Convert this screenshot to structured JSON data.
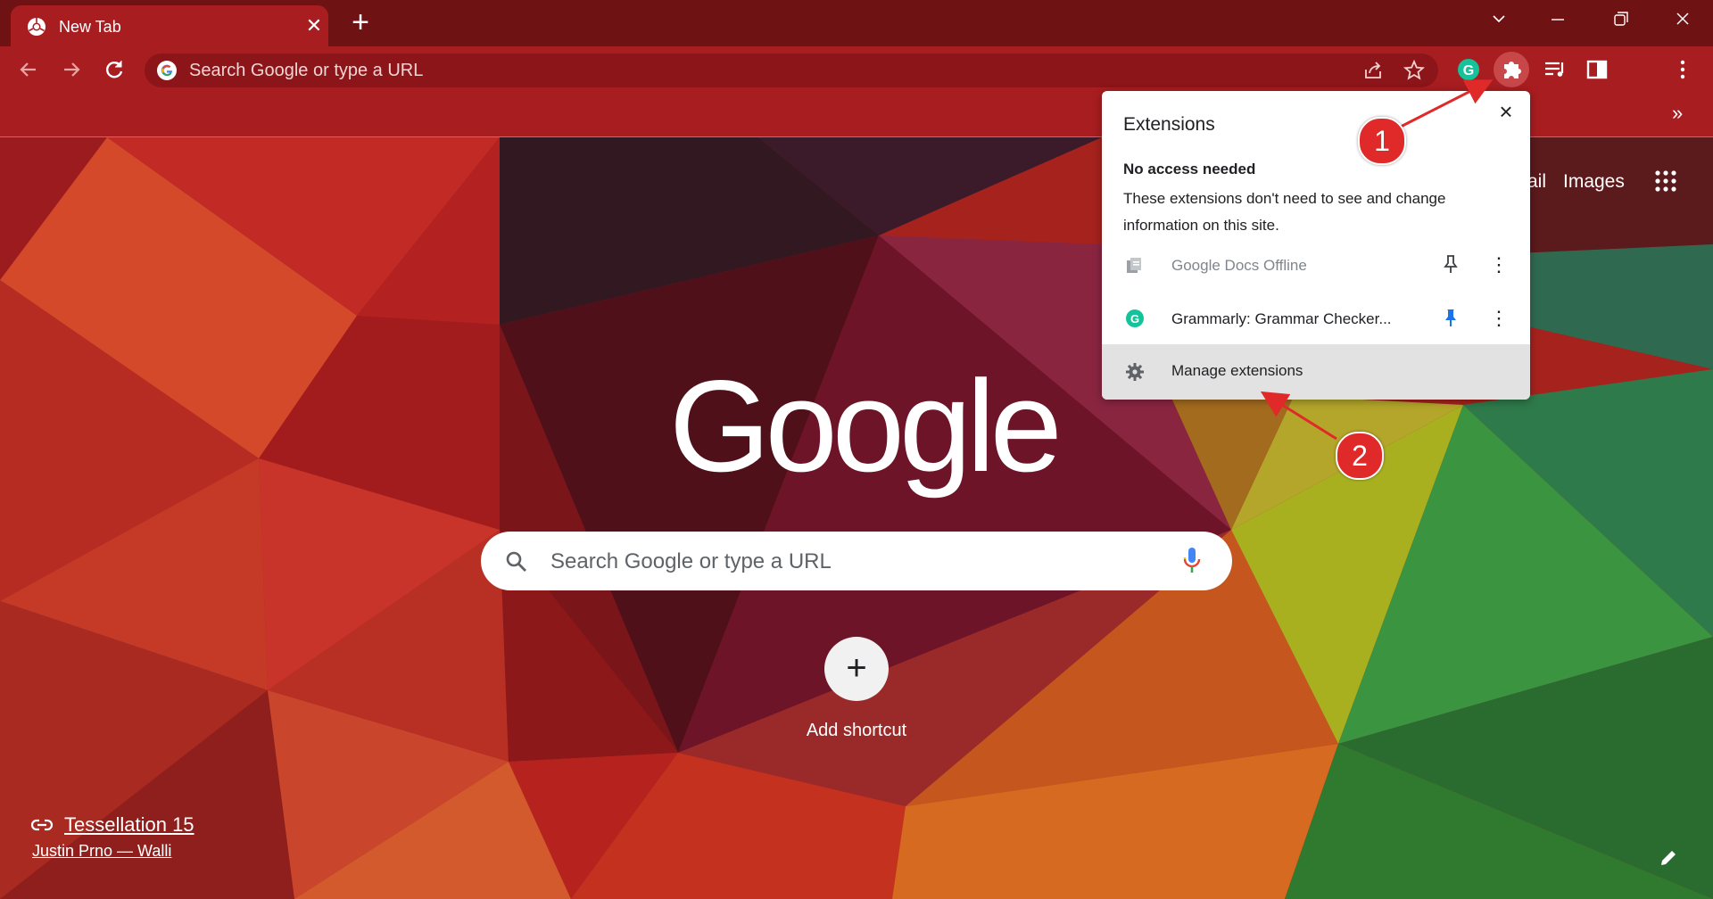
{
  "browser": {
    "tab": {
      "title": "New Tab"
    },
    "omnibox": {
      "placeholder": "Search Google or type a URL"
    }
  },
  "colors": {
    "frame": "#6f1214",
    "toolbar": "#a81d20",
    "grammarly": "#15c39a",
    "pin_active": "#1a73e8",
    "annotation": "#e02a2a"
  },
  "icons": [
    "chrome-icon",
    "close-icon",
    "plus-icon",
    "chevron-down-icon",
    "minimize-icon",
    "restore-icon",
    "back-arrow-icon",
    "forward-arrow-icon",
    "reload-icon",
    "google-g-icon",
    "share-icon",
    "star-icon",
    "grammarly-icon",
    "puzzle-icon",
    "media-queue-icon",
    "side-panel-icon",
    "more-vert-icon",
    "chevron-double-right-icon",
    "search-icon",
    "mic-icon",
    "apps-grid-icon",
    "link-icon",
    "pencil-icon",
    "docs-offline-icon",
    "pin-icon",
    "gear-icon"
  ],
  "ntp": {
    "top_links": {
      "gmail": "ail",
      "images": "Images"
    },
    "logo": "Google",
    "search": {
      "placeholder": "Search Google or type a URL"
    },
    "shortcut": {
      "add_icon": "+",
      "label": "Add shortcut"
    },
    "attribution": {
      "title": "Tessellation 15",
      "author": "Justin Prno — Walli"
    }
  },
  "extensions_popup": {
    "title": "Extensions",
    "section_title": "No access needed",
    "section_desc": "These extensions don't need to see and change information on this site.",
    "items": [
      {
        "name": "Google Docs Offline",
        "pinned": false
      },
      {
        "name": "Grammarly: Grammar Checker...",
        "pinned": true
      }
    ],
    "manage_label": "Manage extensions"
  },
  "annotations": {
    "step1": "1",
    "step2": "2"
  }
}
